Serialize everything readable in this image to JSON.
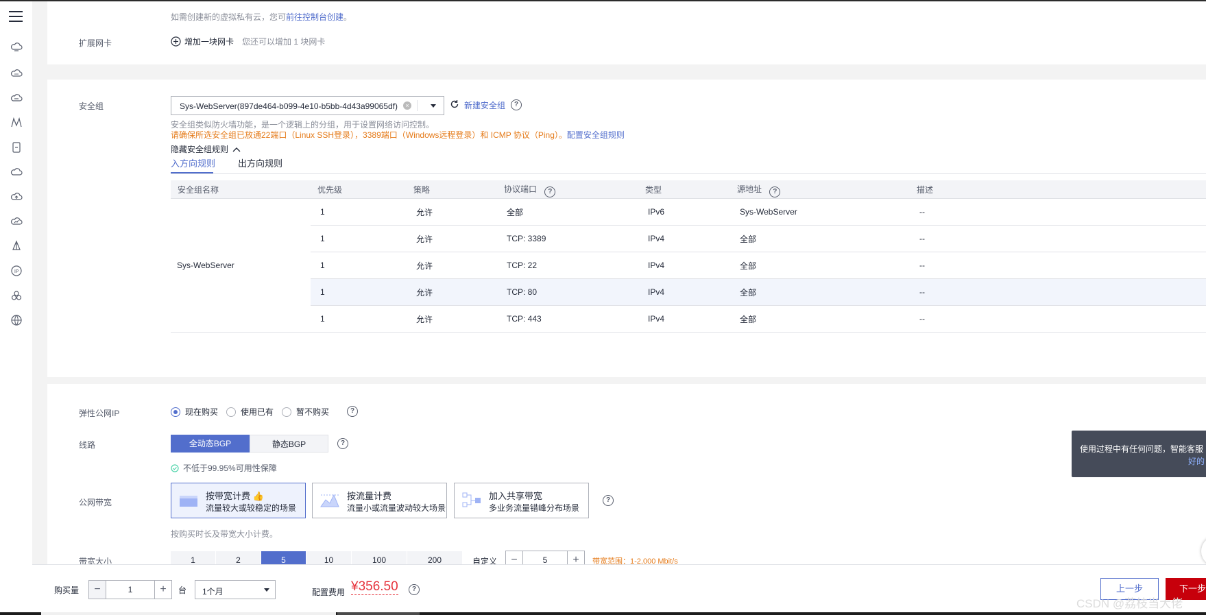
{
  "sidebar": {
    "menu_icon": "menu-icon",
    "icons": [
      "cloud-server-icon",
      "cloud-icon",
      "cloud-host-icon",
      "database-icon",
      "storage-icon",
      "cloud-storage-icon",
      "cloud-upload-icon",
      "cloud-monitor-icon",
      "network-icon",
      "eip-icon",
      "cluster-icon",
      "globe-icon"
    ]
  },
  "vpc": {
    "hint_prefix": "如需创建新的虚拟私有云，您可",
    "hint_link": "前往控制台创建",
    "hint_suffix": "。"
  },
  "nic": {
    "label": "扩展网卡",
    "add_label": "增加一块网卡",
    "remaining": "您还可以增加 1 块网卡"
  },
  "security_group": {
    "label": "安全组",
    "selected": "Sys-WebServer(897de464-b099-4e10-b5bb-4d43a99065df)",
    "create_link": "新建安全组",
    "desc": "安全组类似防火墙功能，是一个逻辑上的分组，用于设置网络访问控制。",
    "warning": "请确保所选安全组已放通22端口（Linux SSH登录），3389端口（Windows远程登录）和 ICMP 协议（Ping）。",
    "config_link": "配置安全组规则",
    "toggle_label": "隐藏安全组规则",
    "tabs": [
      "入方向规则",
      "出方向规则"
    ],
    "columns": [
      "安全组名称",
      "优先级",
      "策略",
      "协议端口",
      "类型",
      "源地址",
      "描述"
    ],
    "group_name": "Sys-WebServer",
    "rows": [
      {
        "priority": "1",
        "policy": "允许",
        "port": "全部",
        "type": "IPv6",
        "source": "Sys-WebServer",
        "desc": "--"
      },
      {
        "priority": "1",
        "policy": "允许",
        "port": "TCP: 3389",
        "type": "IPv4",
        "source": "全部",
        "desc": "--"
      },
      {
        "priority": "1",
        "policy": "允许",
        "port": "TCP: 22",
        "type": "IPv4",
        "source": "全部",
        "desc": "--"
      },
      {
        "priority": "1",
        "policy": "允许",
        "port": "TCP: 80",
        "type": "IPv4",
        "source": "全部",
        "desc": "--"
      },
      {
        "priority": "1",
        "policy": "允许",
        "port": "TCP: 443",
        "type": "IPv4",
        "source": "全部",
        "desc": "--"
      }
    ]
  },
  "eip": {
    "label": "弹性公网IP",
    "options": [
      "现在购买",
      "使用已有",
      "暂不购买"
    ]
  },
  "line": {
    "label": "线路",
    "options": [
      "全动态BGP",
      "静态BGP"
    ],
    "guarantee": "不低于99.95%可用性保障"
  },
  "bandwidth": {
    "label": "公网带宽",
    "cards": [
      {
        "title": "按带宽计费",
        "desc": "流量较大或较稳定的场景"
      },
      {
        "title": "按流量计费",
        "desc": "流量小或流量波动较大场景"
      },
      {
        "title": "加入共享带宽",
        "desc": "多业务流量错峰分布场景"
      }
    ],
    "note": "按购买时长及带宽大小计费。"
  },
  "bandwidth_size": {
    "label": "带宽大小",
    "options": [
      "1",
      "2",
      "5",
      "10",
      "100",
      "200"
    ],
    "custom_label": "自定义",
    "custom_value": "5",
    "range": "带宽范围：1-2,000 Mbit/s"
  },
  "tooltip": {
    "line1": "使用过程中有任何问题，智能客服",
    "line2": "好的"
  },
  "footer": {
    "qty_label": "购买量",
    "qty_value": "1",
    "unit": "台",
    "duration": "1个月",
    "fee_label": "配置费用",
    "fee": "¥356.50",
    "prev": "上一步",
    "next": "下一步",
    "watermark": "CSDN @荔枝当大佬"
  }
}
